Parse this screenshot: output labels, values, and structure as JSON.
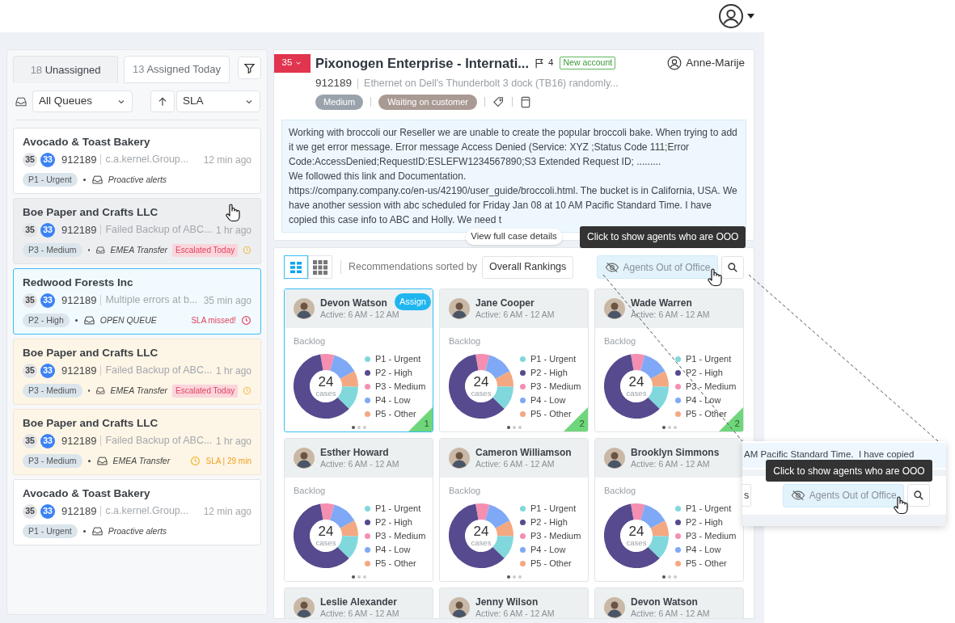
{
  "queue_panel": {
    "tabs": [
      {
        "count": "18",
        "label": "Unassigned",
        "selected": true
      },
      {
        "count": "13",
        "label": "Assigned Today",
        "selected": false
      }
    ],
    "queue_select": "All Queues",
    "sort_select": "SLA",
    "cases": [
      {
        "hovered": false,
        "selected": false,
        "highlighted": false,
        "title": "Avocado & Toast Bakery",
        "badge_gray": "35",
        "badge_blue": "33",
        "id": "912189",
        "subject": "c.a.kernel.Group...",
        "time": "12 min ago",
        "priority": "P1 - Urgent",
        "queue": "Proactive alerts"
      },
      {
        "hovered": true,
        "selected": false,
        "highlighted": false,
        "title": "Boe Paper and Crafts LLC",
        "badge_gray": "35",
        "badge_blue": "33",
        "id": "912189",
        "subject": "Failed Backup of ABC...",
        "time": "1 hr ago",
        "priority": "P3 - Medium",
        "queue": "EMEA Transfer",
        "status": {
          "kind": "escalated",
          "text": "Escalated Today"
        }
      },
      {
        "hovered": false,
        "selected": true,
        "highlighted": false,
        "title": "Redwood Forests Inc",
        "badge_gray": "35",
        "badge_blue": "33",
        "id": "912189",
        "subject": "Multiple errors at b...",
        "time": "35 min ago",
        "priority": "P2 - High",
        "queue": "OPEN QUEUE",
        "status": {
          "kind": "sla_missed",
          "text": "SLA missed!"
        }
      },
      {
        "hovered": false,
        "selected": false,
        "highlighted": true,
        "title": "Boe Paper and Crafts LLC",
        "badge_gray": "35",
        "badge_blue": "33",
        "id": "912189",
        "subject": "Failed Backup of ABC...",
        "time": "1 hr ago",
        "priority": "P3 - Medium",
        "queue": "EMEA Transfer",
        "status": {
          "kind": "escalated",
          "text": "Escalated Today"
        }
      },
      {
        "hovered": false,
        "selected": false,
        "highlighted": true,
        "title": "Boe Paper and Crafts LLC",
        "badge_gray": "35",
        "badge_blue": "33",
        "id": "912189",
        "subject": "Failed Backup of ABC...",
        "time": "1 hr ago",
        "priority": "P3 - Medium",
        "queue": "EMEA Transfer",
        "status": {
          "kind": "sla_timer",
          "text": "SLA | 29 min"
        }
      },
      {
        "hovered": false,
        "selected": false,
        "highlighted": false,
        "title": "Avocado & Toast Bakery",
        "badge_gray": "35",
        "badge_blue": "33",
        "id": "912189",
        "subject": "c.a.kernel.Group...",
        "time": "12 min ago",
        "priority": "P1 - Urgent",
        "queue": "Proactive alerts"
      }
    ]
  },
  "case": {
    "priority_badge": "35",
    "title": "Pixonogen Enterprise - Internati...",
    "flag_count": "4",
    "account_tag": "New account",
    "assignee": "Anne-Marije",
    "id": "912189",
    "subject": "Ethernet on Dell's Thunderbolt 3 dock (TB16) randomly...",
    "priority": "Medium",
    "status": "Waiting on customer",
    "description": [
      "Working with broccoli our Reseller we are unable to create the popular broccoli bake. When trying to add it we get error message. Error message Access Denied (Service: XYZ ;Status Code 111;Error Code:AccessDenied;RequestID:ESLEFW1234567890;S3 Extended Request ID; .........",
      "We followed this link and Documentation.",
      "https://company.company.co/en-us/42190/user_guide/broccoli.html. The bucket is in California, USA.  We have another session with abc scheduled for Friday Jan 08 at 10 AM Pacific Standard Time.  I have copied this case info to ABC and Holly. We need t"
    ],
    "details_button": "View full case details"
  },
  "recommendations": {
    "views": [
      {
        "kind": "list",
        "selected": true
      },
      {
        "kind": "grid",
        "selected": false
      }
    ],
    "sorted_label": "Recommendations sorted by",
    "sort_button": "Overall Rankings",
    "ooo_button": "Agents Out of Office",
    "ooo_hovered": true,
    "ooo_tooltip": "Click to show agents who are OOO",
    "agents": [
      {
        "name": "Devon Watson",
        "active": "Active: 6 AM - 12 AM",
        "selected": true,
        "assign_label": "Assign",
        "rank": "1",
        "backlog_title": "Backlog",
        "total": "24",
        "total_unit": "cases",
        "legend": [
          {
            "label": "P1 - Urgent",
            "color": "#80d8dc"
          },
          {
            "label": "P2 - High",
            "color": "#574a8e"
          },
          {
            "label": "P3 - Medium",
            "color": "#f48fb1"
          },
          {
            "label": "P4 - Low",
            "color": "#7fa8f6"
          },
          {
            "label": "P5 - Other",
            "color": "#f4a882"
          }
        ]
      },
      {
        "name": "Jane Cooper",
        "active": "Active: 6 AM - 12 AM",
        "selected": false,
        "rank": "2",
        "backlog_title": "Backlog",
        "total": "24",
        "total_unit": "cases",
        "legend": [
          {
            "label": "P1 - Urgent",
            "color": "#80d8dc"
          },
          {
            "label": "P2 - High",
            "color": "#574a8e"
          },
          {
            "label": "P3 - Medium",
            "color": "#f48fb1"
          },
          {
            "label": "P4 - Low",
            "color": "#7fa8f6"
          },
          {
            "label": "P5 - Other",
            "color": "#f4a882"
          }
        ]
      },
      {
        "name": "Wade Warren",
        "active": "Active: 6 AM - 12 AM",
        "selected": false,
        "rank": "2",
        "backlog_title": "Backlog",
        "total": "24",
        "total_unit": "cases",
        "legend": [
          {
            "label": "P1 - Urgent",
            "color": "#80d8dc"
          },
          {
            "label": "P2 - High",
            "color": "#574a8e"
          },
          {
            "label": "P3 - Medium",
            "color": "#f48fb1"
          },
          {
            "label": "P4 - Low",
            "color": "#7fa8f6"
          },
          {
            "label": "P5 - Other",
            "color": "#f4a882"
          }
        ]
      },
      {
        "name": "Esther Howard",
        "active": "Active: 6 AM - 12 AM",
        "selected": false,
        "backlog_title": "Backlog",
        "total": "24",
        "total_unit": "cases",
        "legend": [
          {
            "label": "P1 - Urgent",
            "color": "#80d8dc"
          },
          {
            "label": "P2 - High",
            "color": "#574a8e"
          },
          {
            "label": "P3 - Medium",
            "color": "#f48fb1"
          },
          {
            "label": "P4 - Low",
            "color": "#7fa8f6"
          },
          {
            "label": "P5 - Other",
            "color": "#f4a882"
          }
        ]
      },
      {
        "name": "Cameron Williamson",
        "active": "Active: 6 AM - 12 AM",
        "selected": false,
        "backlog_title": "Backlog",
        "total": "24",
        "total_unit": "cases",
        "legend": [
          {
            "label": "P1 - Urgent",
            "color": "#80d8dc"
          },
          {
            "label": "P2 - High",
            "color": "#574a8e"
          },
          {
            "label": "P3 - Medium",
            "color": "#f48fb1"
          },
          {
            "label": "P4 - Low",
            "color": "#7fa8f6"
          },
          {
            "label": "P5 - Other",
            "color": "#f4a882"
          }
        ]
      },
      {
        "name": "Brooklyn Simmons",
        "active": "Active: 6 AM - 12 AM",
        "selected": false,
        "backlog_title": "Backlog",
        "total": "24",
        "total_unit": "cases",
        "legend": [
          {
            "label": "P1 - Urgent",
            "color": "#80d8dc"
          },
          {
            "label": "P2 - High",
            "color": "#574a8e"
          },
          {
            "label": "P3 - Medium",
            "color": "#f48fb1"
          },
          {
            "label": "P4 - Low",
            "color": "#7fa8f6"
          },
          {
            "label": "P5 - Other",
            "color": "#f4a882"
          }
        ]
      },
      {
        "name": "Leslie Alexander",
        "active": "Active: 6 AM - 12 AM",
        "selected": false
      },
      {
        "name": "Jenny Wilson",
        "active": "Active: 6 AM - 12 AM",
        "selected": false
      },
      {
        "name": "Devon Watson",
        "active": "Active: 6 AM - 12 AM",
        "selected": false
      }
    ]
  },
  "zoom_callout": {
    "description_fragment": "AM Pacific Standard Time.  I have copied",
    "sort_button_fragment": "s",
    "ooo_button": "Agents Out of Office",
    "ooo_hovered": true,
    "ooo_tooltip": "Click to show agents who are OOO"
  }
}
